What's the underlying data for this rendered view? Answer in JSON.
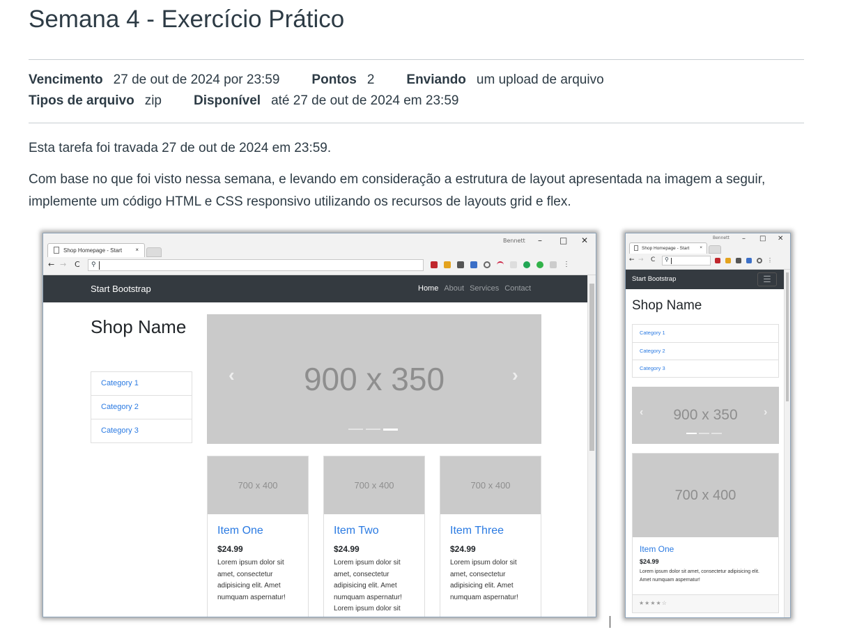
{
  "page": {
    "title": "Semana 4 - Exercício Prático",
    "meta_row1": [
      {
        "label": "Vencimento",
        "value": "27 de out de 2024 por 23:59"
      },
      {
        "label": "Pontos",
        "value": "2"
      },
      {
        "label": "Enviando",
        "value": "um upload de arquivo"
      }
    ],
    "meta_row2": [
      {
        "label": "Tipos de arquivo",
        "value": "zip"
      },
      {
        "label": "Disponível",
        "value": "até 27 de out de 2024 em 23:59"
      }
    ],
    "locked_text": "Esta tarefa foi travada 27 de out de 2024 em 23:59.",
    "instructions": "Com base no que foi visto nessa semana, e levando em consideração a estrutura de layout apresentada na imagem a seguir, implemente um código HTML e CSS responsivo utilizando os recursos de layouts grid e flex."
  },
  "desktop": {
    "tab_title": "Shop Homepage - Start",
    "tab_close": "×",
    "window_label": "Bennett",
    "controls": {
      "minimize": "–",
      "maximize": "□",
      "close": "✕"
    },
    "address_text": "",
    "brand": "Start Bootstrap",
    "nav": [
      "Home",
      "About",
      "Services",
      "Contact"
    ],
    "shop_name": "Shop Name",
    "categories": [
      "Category 1",
      "Category 2",
      "Category 3"
    ],
    "carousel_label": "900 x 350",
    "carousel_prev": "‹",
    "carousel_next": "›",
    "cards": [
      {
        "img": "700 x 400",
        "title": "Item One",
        "price": "$24.99",
        "text": "Lorem ipsum dolor sit amet, consectetur adipisicing elit. Amet numquam aspernatur!"
      },
      {
        "img": "700 x 400",
        "title": "Item Two",
        "price": "$24.99",
        "text": "Lorem ipsum dolor sit amet, consectetur adipisicing elit. Amet numquam aspernatur! Lorem ipsum dolor sit"
      },
      {
        "img": "700 x 400",
        "title": "Item Three",
        "price": "$24.99",
        "text": "Lorem ipsum dolor sit amet, consectetur adipisicing elit. Amet numquam aspernatur!"
      }
    ]
  },
  "mobile": {
    "tab_title": "Shop Homepage - Start",
    "tab_close": "×",
    "window_label": "Bennett",
    "controls": {
      "minimize": "–",
      "maximize": "□",
      "close": "✕"
    },
    "brand": "Start Bootstrap",
    "menu_icon": "☰",
    "shop_name": "Shop Name",
    "categories": [
      "Category 1",
      "Category 2",
      "Category 3"
    ],
    "carousel_label": "900 x 350",
    "carousel_prev": "‹",
    "carousel_next": "›",
    "card": {
      "img": "700 x 400",
      "title": "Item One",
      "price": "$24.99",
      "text": "Lorem ipsum dolor sit amet, consectetur adipisicing elit. Amet numquam aspernatur!",
      "rating": "★★★★☆"
    }
  },
  "colors": {
    "link": "#2a7ae2",
    "navbar": "#343a40",
    "placeholder": "#cacaca"
  }
}
